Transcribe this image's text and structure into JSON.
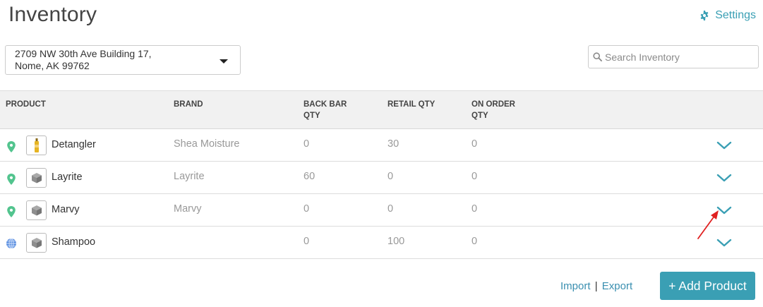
{
  "header": {
    "title": "Inventory",
    "settings_label": "Settings"
  },
  "location": {
    "line1": "2709 NW 30th Ave Building 17,",
    "line2": "Nome, AK 99762"
  },
  "search": {
    "placeholder": "Search Inventory"
  },
  "table": {
    "columns": [
      "PRODUCT",
      "BRAND",
      "BACK BAR QTY",
      "RETAIL QTY",
      "ON ORDER QTY"
    ],
    "rows": [
      {
        "product": "Detangler",
        "brand": "Shea Moisture",
        "back_bar_qty": "0",
        "retail_qty": "30",
        "on_order_qty": "0",
        "scope_icon": "map-pin-icon",
        "thumb_icon": "bottle-icon"
      },
      {
        "product": "Layrite",
        "brand": "Layrite",
        "back_bar_qty": "60",
        "retail_qty": "0",
        "on_order_qty": "0",
        "scope_icon": "map-pin-icon",
        "thumb_icon": "box-icon"
      },
      {
        "product": "Marvy",
        "brand": "Marvy",
        "back_bar_qty": "0",
        "retail_qty": "0",
        "on_order_qty": "0",
        "scope_icon": "map-pin-icon",
        "thumb_icon": "box-icon"
      },
      {
        "product": "Shampoo",
        "brand": "",
        "back_bar_qty": "0",
        "retail_qty": "100",
        "on_order_qty": "0",
        "scope_icon": "globe-icon",
        "thumb_icon": "box-icon"
      }
    ]
  },
  "footer": {
    "import_label": "Import",
    "separator": "|",
    "export_label": "Export",
    "add_product_label": "+ Add Product"
  },
  "colors": {
    "accent": "#3a9fb4",
    "pin": "#52c48e",
    "globe": "#4f7ed6",
    "annotation": "#e02020"
  }
}
